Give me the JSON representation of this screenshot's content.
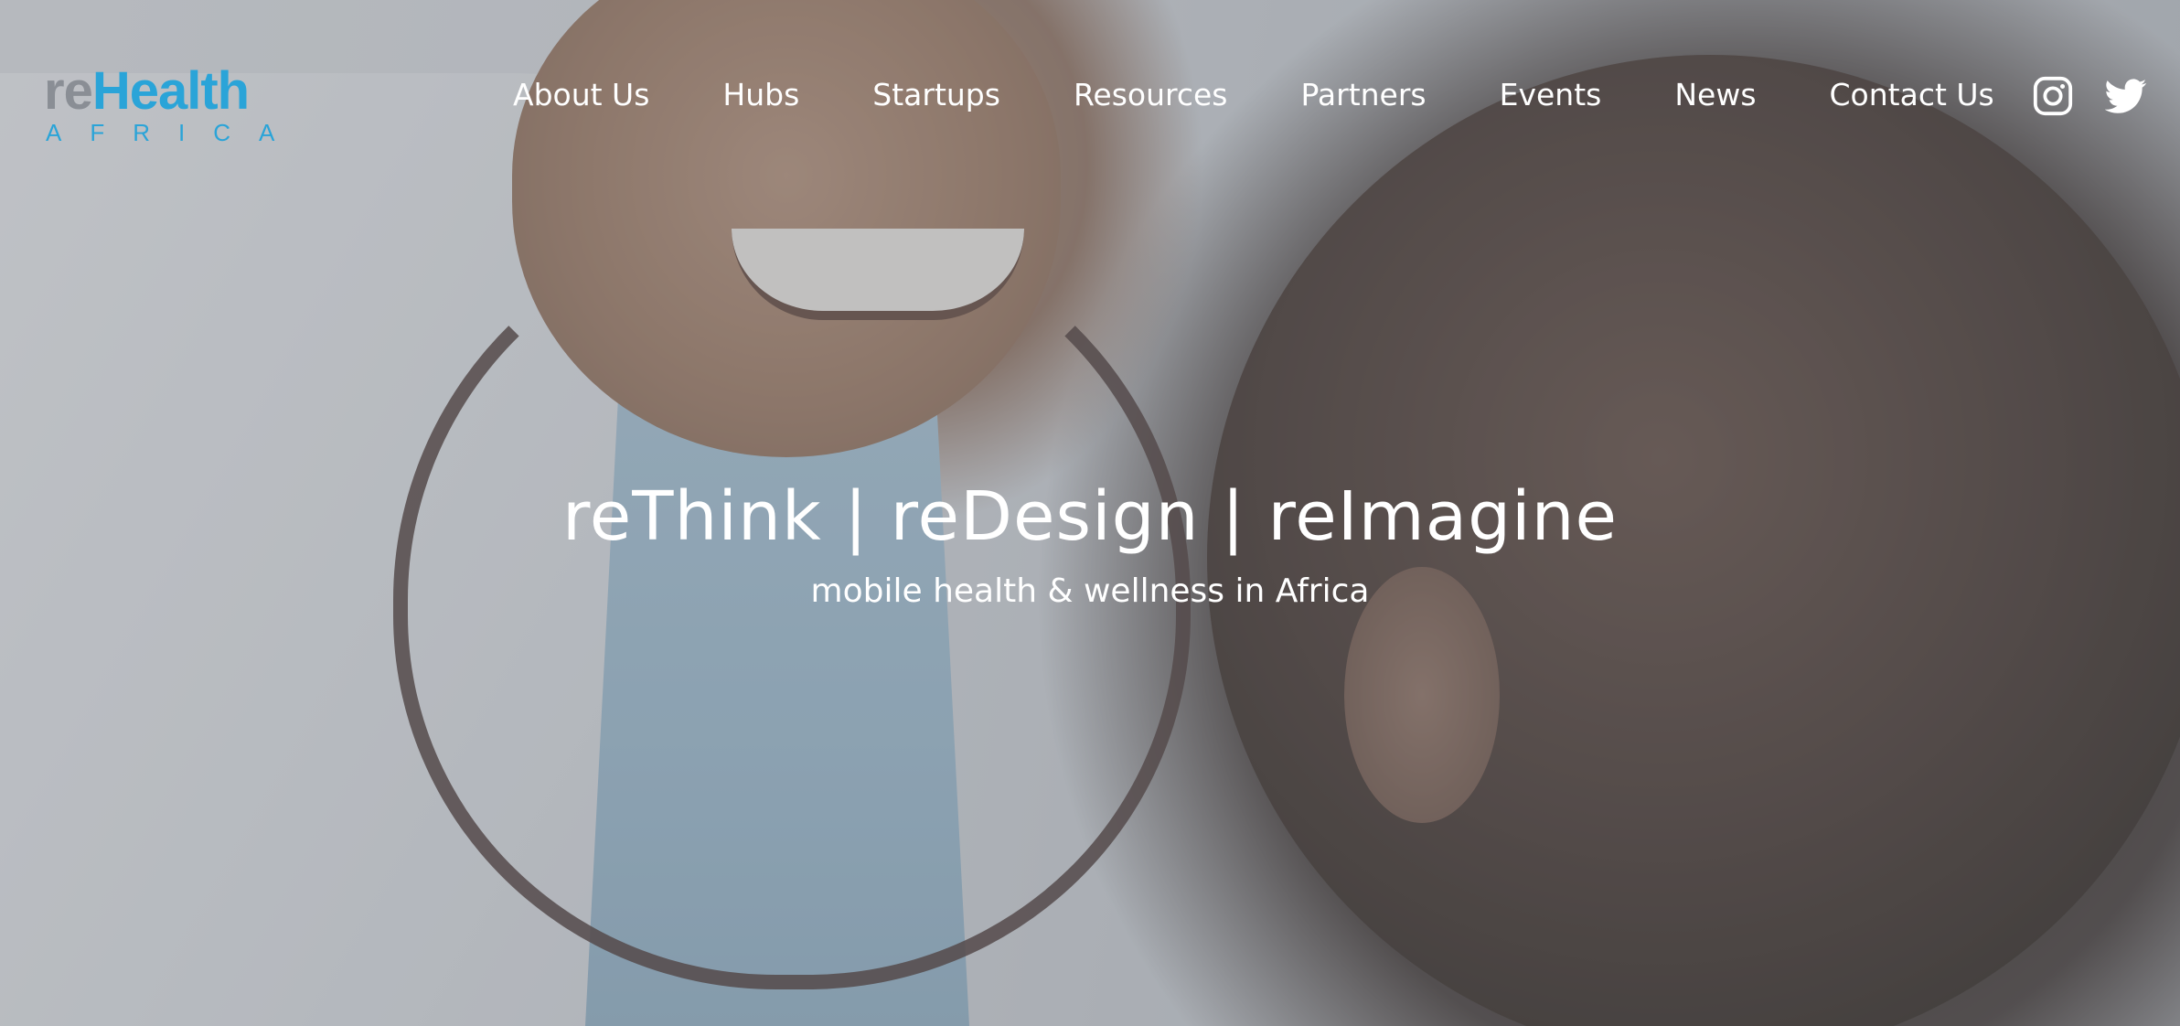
{
  "header": {
    "logo": {
      "prefix": "re",
      "name": "Health",
      "sub": "AFRICA"
    },
    "nav_items": [
      {
        "label": "About Us"
      },
      {
        "label": "Hubs"
      },
      {
        "label": "Startups"
      },
      {
        "label": "Resources"
      },
      {
        "label": "Partners"
      },
      {
        "label": "Events"
      },
      {
        "label": "News"
      },
      {
        "label": "Contact Us"
      }
    ],
    "social": [
      {
        "icon": "instagram-icon"
      },
      {
        "icon": "twitter-icon"
      }
    ]
  },
  "hero": {
    "tagline": "reThink | reDesign | reImagine",
    "subtitle": "mobile health & wellness in Africa"
  },
  "colors": {
    "brand_blue": "#2aa4d8",
    "brand_gray": "#8a8e95",
    "nav_text": "#ffffff"
  }
}
